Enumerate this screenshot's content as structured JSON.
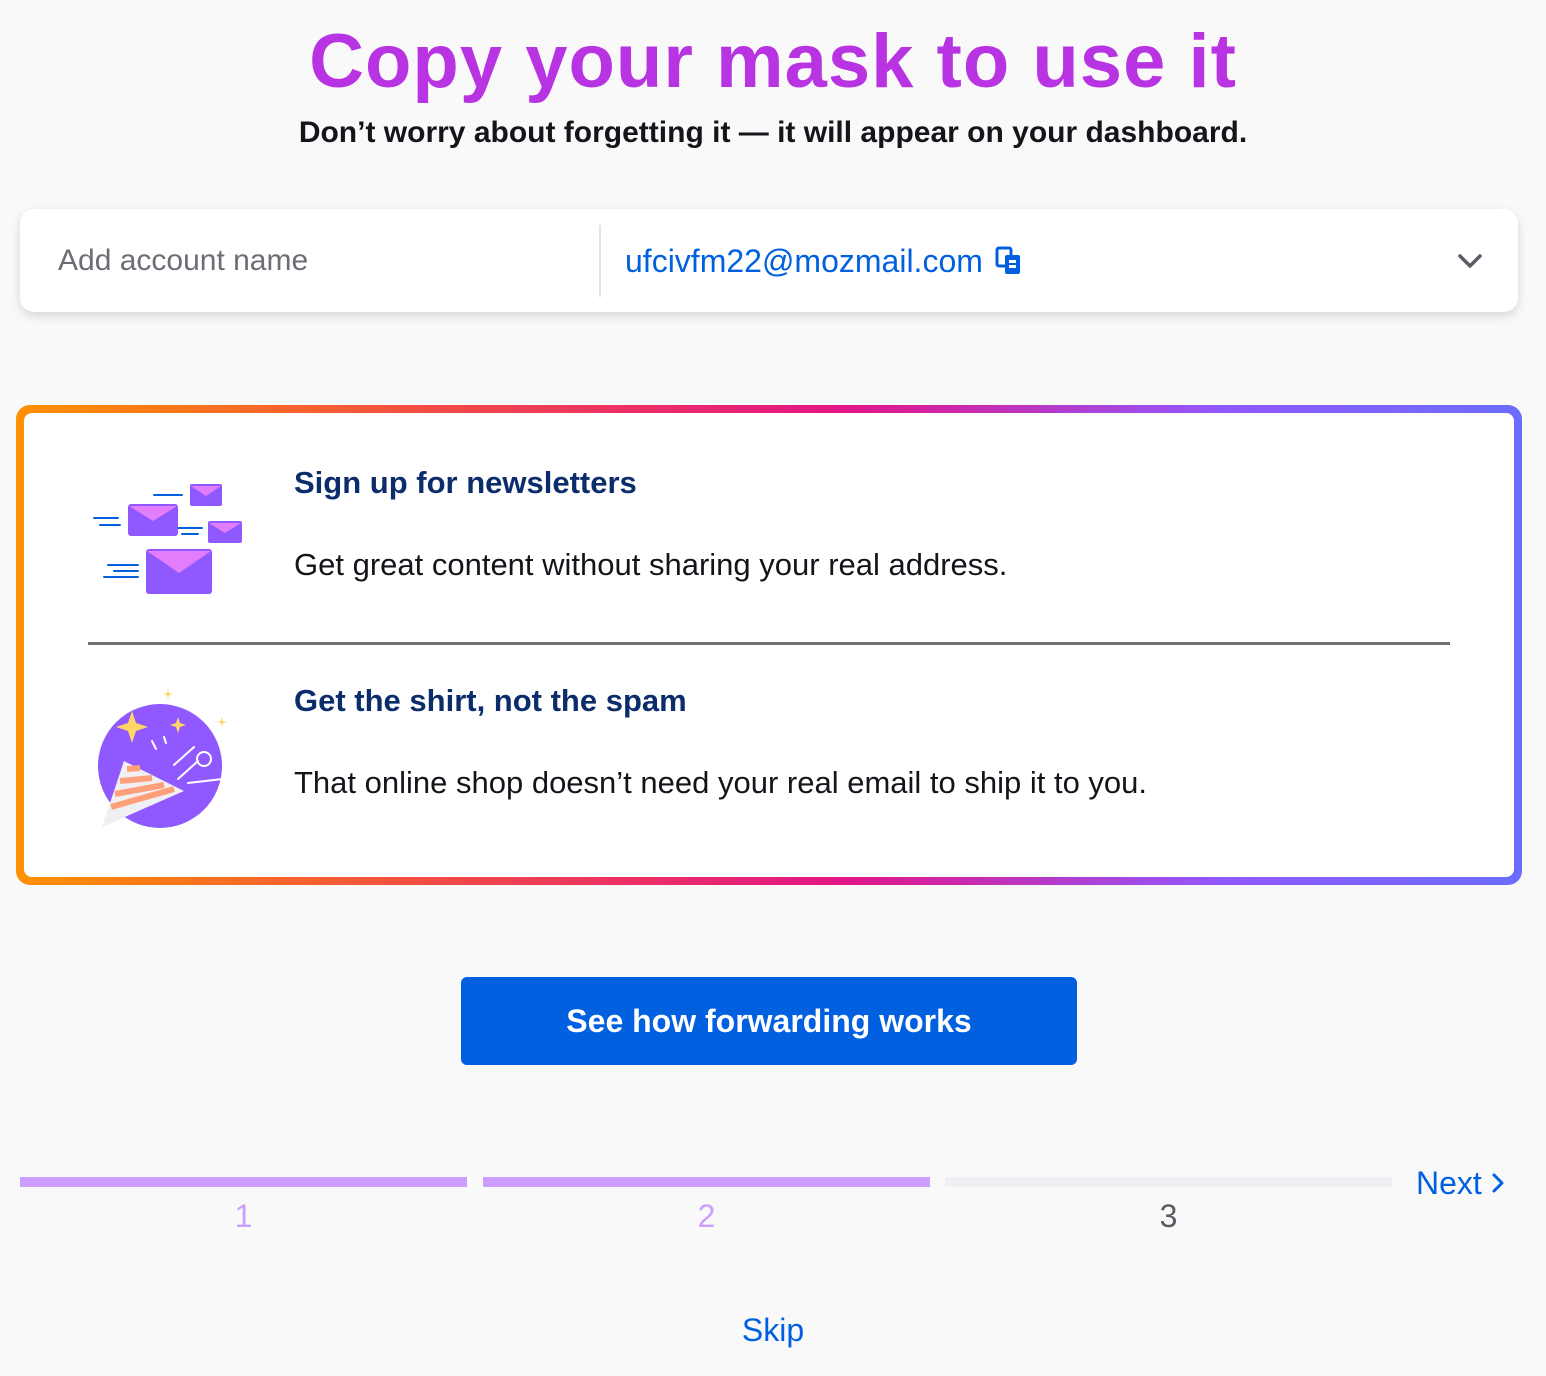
{
  "header": {
    "title": "Copy your mask to use it",
    "subtitle": "Don’t worry about forgetting it — it will appear on your dashboard."
  },
  "mask": {
    "account_placeholder": "Add account name",
    "address": "ufcivfm22@mozmail.com",
    "copy_icon": "copy-icon",
    "expand_icon": "chevron-down-icon"
  },
  "features": [
    {
      "icon": "envelopes-icon",
      "heading": "Sign up for newsletters",
      "body": "Get great content without sharing your real address."
    },
    {
      "icon": "party-popper-icon",
      "heading": "Get the shirt, not the spam",
      "body": "That online shop doesn’t need your real email to ship it to you."
    }
  ],
  "cta": {
    "label": "See how forwarding works"
  },
  "progress": {
    "steps": [
      {
        "label": "1",
        "completed": true
      },
      {
        "label": "2",
        "completed": true
      },
      {
        "label": "3",
        "completed": false
      }
    ],
    "current_step": 2,
    "next_label": "Next"
  },
  "skip_label": "Skip",
  "colors": {
    "accent": "#b833e1",
    "link": "#0060df",
    "step_done": "#cb9eff",
    "step_todo": "#f0f0f4",
    "heading": "#0c2d6b"
  }
}
